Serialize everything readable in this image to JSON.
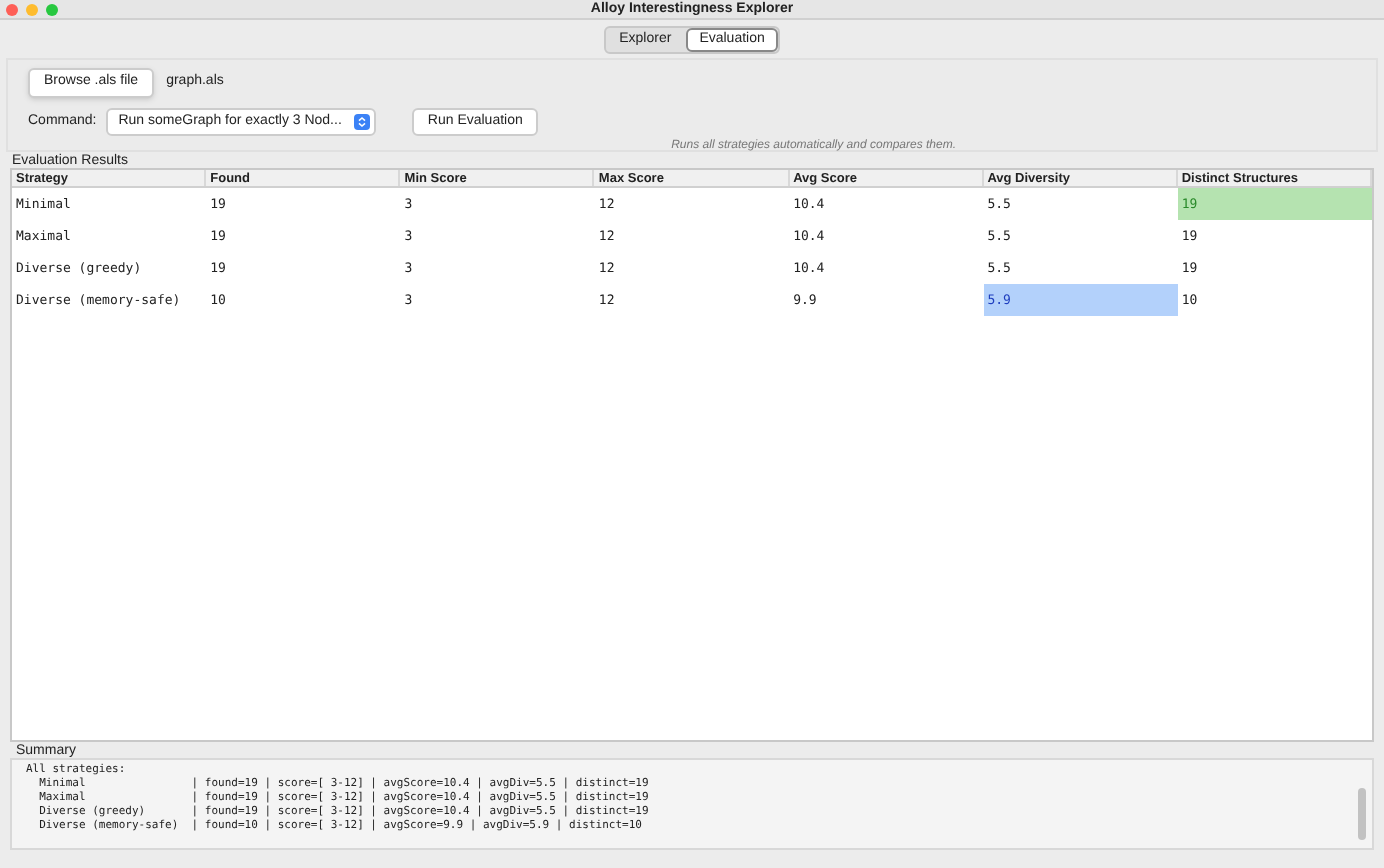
{
  "window": {
    "title": "Alloy Interestingness Explorer"
  },
  "tabs": [
    {
      "label": "Explorer",
      "selected": false
    },
    {
      "label": "Evaluation",
      "selected": true
    }
  ],
  "file": {
    "button": "Browse .als file",
    "name": "graph.als"
  },
  "command": {
    "label": "Command:",
    "value": "Run someGraph for exactly 3 Nod...",
    "run_button": "Run Evaluation",
    "hint": "Runs all strategies automatically and compares them."
  },
  "results": {
    "title": "Evaluation Results",
    "columns": [
      "Strategy",
      "Found",
      "Min Score",
      "Max Score",
      "Avg Score",
      "Avg Diversity",
      "Distinct Structures"
    ],
    "rows": [
      {
        "cells": [
          {
            "text": "Minimal",
            "best": false,
            "selected": false
          },
          {
            "text": "19",
            "best": false,
            "selected": false
          },
          {
            "text": "3",
            "best": false,
            "selected": false
          },
          {
            "text": "12",
            "best": false,
            "selected": false
          },
          {
            "text": "10.4",
            "best": false,
            "selected": false
          },
          {
            "text": "5.5",
            "best": false,
            "selected": false
          },
          {
            "text": "19",
            "best": true,
            "selected": false
          }
        ]
      },
      {
        "cells": [
          {
            "text": "Maximal",
            "best": false,
            "selected": false
          },
          {
            "text": "19",
            "best": false,
            "selected": false
          },
          {
            "text": "3",
            "best": false,
            "selected": false
          },
          {
            "text": "12",
            "best": false,
            "selected": false
          },
          {
            "text": "10.4",
            "best": false,
            "selected": false
          },
          {
            "text": "5.5",
            "best": false,
            "selected": false
          },
          {
            "text": "19",
            "best": false,
            "selected": false
          }
        ]
      },
      {
        "cells": [
          {
            "text": "Diverse (greedy)",
            "best": false,
            "selected": false
          },
          {
            "text": "19",
            "best": false,
            "selected": false
          },
          {
            "text": "3",
            "best": false,
            "selected": false
          },
          {
            "text": "12",
            "best": false,
            "selected": false
          },
          {
            "text": "10.4",
            "best": false,
            "selected": false
          },
          {
            "text": "5.5",
            "best": false,
            "selected": false
          },
          {
            "text": "19",
            "best": false,
            "selected": false
          }
        ]
      },
      {
        "cells": [
          {
            "text": "Diverse (memory-safe)",
            "best": false,
            "selected": false
          },
          {
            "text": "10",
            "best": false,
            "selected": false
          },
          {
            "text": "3",
            "best": false,
            "selected": false
          },
          {
            "text": "12",
            "best": false,
            "selected": false
          },
          {
            "text": "9.9",
            "best": false,
            "selected": false
          },
          {
            "text": "5.9",
            "best": false,
            "selected": true
          },
          {
            "text": "10",
            "best": false,
            "selected": false
          }
        ]
      }
    ]
  },
  "summary": {
    "title": "Summary",
    "lines": [
      "All strategies:",
      "  Minimal                | found=19 | score=[ 3-12] | avgScore=10.4 | avgDiv=5.5 | distinct=19",
      "  Maximal                | found=19 | score=[ 3-12] | avgScore=10.4 | avgDiv=5.5 | distinct=19",
      "  Diverse (greedy)       | found=19 | score=[ 3-12] | avgScore=10.4 | avgDiv=5.5 | distinct=19",
      "  Diverse (memory-safe)  | found=10 | score=[ 3-12] | avgScore=9.9 | avgDiv=5.9 | distinct=10"
    ]
  }
}
